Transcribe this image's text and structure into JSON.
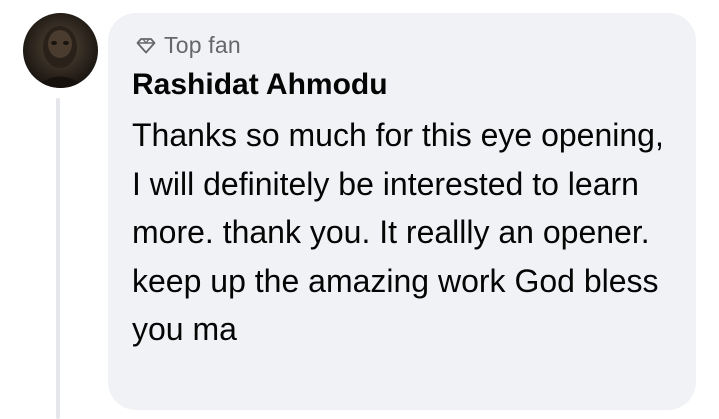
{
  "comment": {
    "badge": {
      "icon": "diamond-icon",
      "label": "Top fan"
    },
    "author": "Rashidat Ahmodu",
    "text": "Thanks so much for this eye opening, I will definitely be interested to learn more. thank you. It reallly an opener. keep up the amazing work God bless you ma",
    "bubble_color": "#f0f2f5",
    "secondary_text_color": "#65676b"
  }
}
